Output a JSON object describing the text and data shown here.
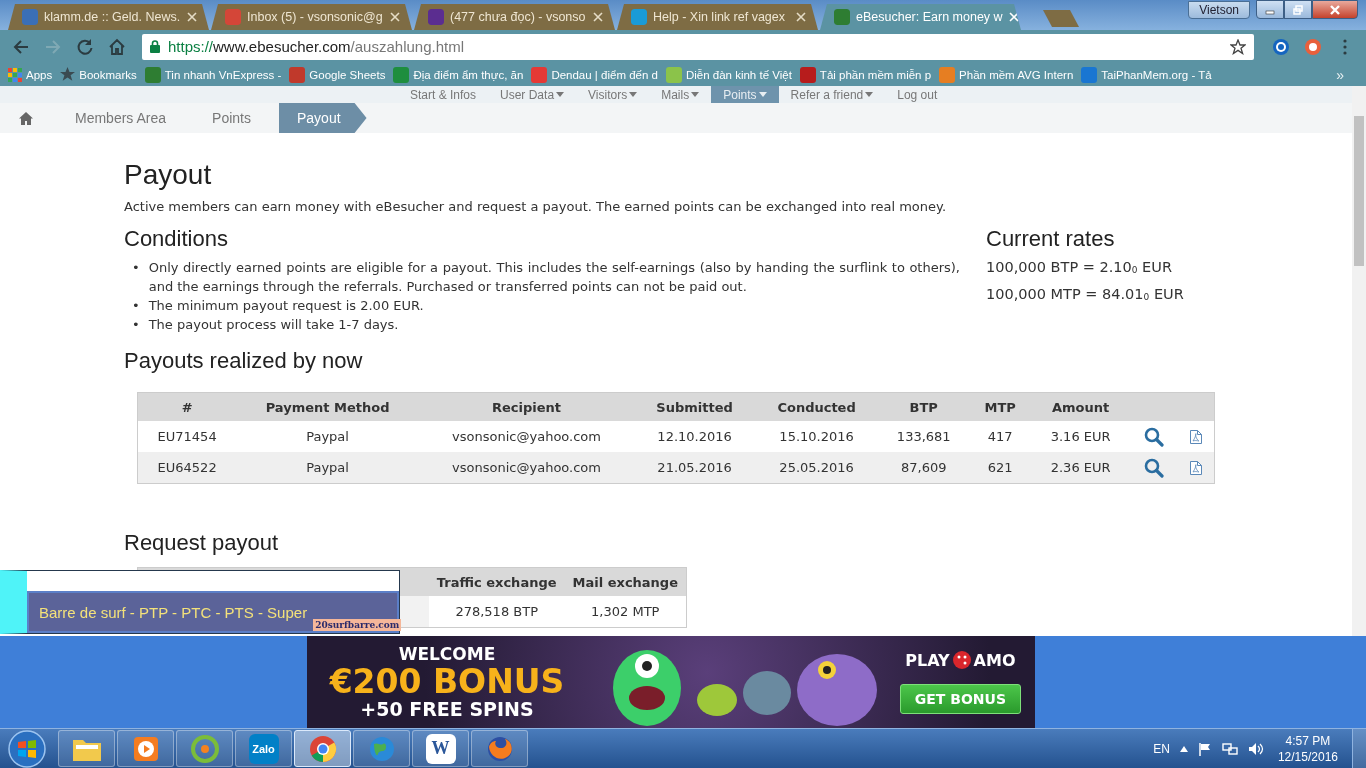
{
  "browser": {
    "tabs": [
      {
        "title": "klamm.de :: Geld. News.",
        "selected": false
      },
      {
        "title": "Inbox (5) - vsonsonic@g",
        "selected": false
      },
      {
        "title": "(477 chưa đọc) - vsonso",
        "selected": false
      },
      {
        "title": "Help - Xin link ref vagex",
        "selected": false
      },
      {
        "title": "eBesucher: Earn money w",
        "selected": true
      }
    ],
    "user": "Vietson",
    "url": {
      "scheme": "https://",
      "host": "www.ebesucher.com",
      "path": "/auszahlung.html"
    },
    "bookmarks": [
      {
        "kind": "apps",
        "label": "Apps"
      },
      {
        "kind": "star",
        "label": "Bookmarks"
      },
      {
        "kind": "site",
        "label": "Tin nhanh VnExpress -"
      },
      {
        "kind": "site",
        "label": "Google Sheets"
      },
      {
        "kind": "site",
        "label": "Địa điểm ẩm thực, ăn"
      },
      {
        "kind": "site",
        "label": "Dendau | điểm đến d"
      },
      {
        "kind": "site",
        "label": "Diễn đàn kinh tế Việt"
      },
      {
        "kind": "site",
        "label": "Tải phần mềm miễn p"
      },
      {
        "kind": "site",
        "label": "Phần mềm AVG Intern"
      },
      {
        "kind": "site",
        "label": "TaiPhanMem.org - Tả"
      }
    ],
    "bookmarks_more": "»"
  },
  "nav": {
    "items": [
      {
        "label": "Start & Infos",
        "dropdown": false,
        "selected": false
      },
      {
        "label": "User Data",
        "dropdown": true,
        "selected": false
      },
      {
        "label": "Visitors",
        "dropdown": true,
        "selected": false
      },
      {
        "label": "Mails",
        "dropdown": true,
        "selected": false
      },
      {
        "label": "Points",
        "dropdown": true,
        "selected": true
      },
      {
        "label": "Refer a friend",
        "dropdown": true,
        "selected": false
      },
      {
        "label": "Log out",
        "dropdown": false,
        "selected": false
      }
    ]
  },
  "breadcrumb": {
    "items": [
      {
        "label": "Members Area",
        "selected": false
      },
      {
        "label": "Points",
        "selected": false
      },
      {
        "label": "Payout",
        "selected": true
      }
    ]
  },
  "page": {
    "title": "Payout",
    "intro": "Active members can earn money with eBesucher and request a payout. The earned points can be exchanged into real money.",
    "conditions": {
      "heading": "Conditions",
      "bullet": "•",
      "items": [
        "Only directly earned points are eligible for a payout. This includes the self-earnings (also by handing the surflink to others), and the earnings through the referrals. Purchased or transferred points can not be paid out.",
        "The minimum payout request is 2.00 EUR.",
        "The payout process will take 1-7 days."
      ]
    },
    "rates": {
      "heading": "Current rates",
      "lines": [
        "100,000 BTP = 2.10$_{0}$ EUR",
        "100,000 MTP = 84.01$_{0}$ EUR"
      ]
    },
    "payouts": {
      "heading": "Payouts realized by now",
      "columns": [
        "#",
        "Payment Method",
        "Recipient",
        "Submitted",
        "Conducted",
        "BTP",
        "MTP",
        "Amount"
      ],
      "rows": [
        {
          "cells": [
            "EU71454",
            "Paypal",
            "vsonsonic@yahoo.com",
            "12.10.2016",
            "15.10.2016",
            "133,681",
            "417",
            "3.16 EUR"
          ]
        },
        {
          "cells": [
            "EU64522",
            "Paypal",
            "vsonsonic@yahoo.com",
            "21.05.2016",
            "25.05.2016",
            "87,609",
            "621",
            "2.36 EUR"
          ]
        }
      ]
    },
    "request": {
      "heading": "Request payout",
      "columns": [
        "Traffic exchange",
        "Mail exchange"
      ],
      "rows": [
        {
          "cells": [
            "278,518 BTP",
            "1,302 MTP"
          ]
        }
      ]
    }
  },
  "overlay_ad": {
    "title": "Barre de surf - PTP - PTC - PTS - Super",
    "site": "20surfbarre.com"
  },
  "banner_ad": {
    "line_1": "WELCOME",
    "line_2": "€200 BONUS",
    "line_3": "+50 FREE SPINS",
    "brand_left": "PLAY",
    "brand_right": "AMO",
    "button": "GET BONUS"
  },
  "taskbar": {
    "apps": [
      {
        "kind": "folder",
        "active": false
      },
      {
        "kind": "media",
        "active": false
      },
      {
        "kind": "coccoc",
        "active": false
      },
      {
        "kind": "zalo",
        "label": "Zalo",
        "active": false
      },
      {
        "kind": "chrome",
        "active": true
      },
      {
        "kind": "globe",
        "active": false
      },
      {
        "kind": "word",
        "label": "W",
        "active": false
      },
      {
        "kind": "firefox",
        "active": false
      }
    ],
    "language": "EN",
    "time": "4:57 PM",
    "date": "12/15/2016"
  }
}
